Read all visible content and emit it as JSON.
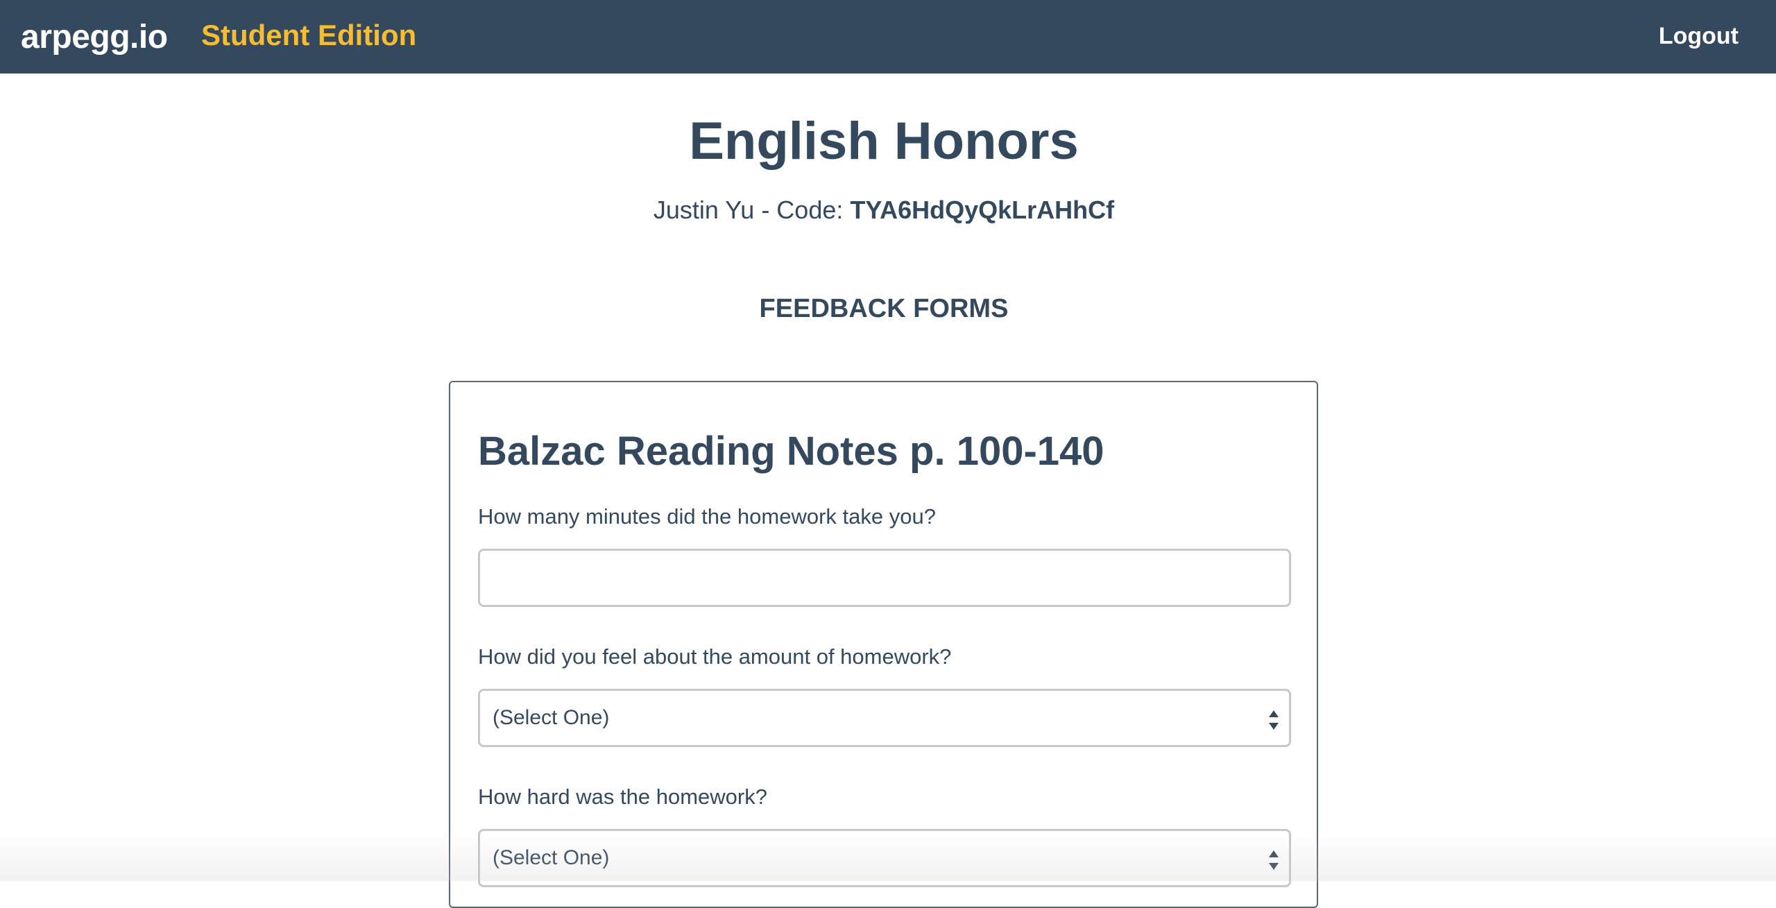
{
  "navbar": {
    "brand": "arpegg.io",
    "edition": "Student Edition",
    "logout_label": "Logout"
  },
  "course": {
    "title": "English Honors",
    "student_prefix": "Justin Yu - Code: ",
    "code": "TYA6HdQyQkLrAHhCf"
  },
  "section": {
    "heading": "FEEDBACK FORMS"
  },
  "form": {
    "title": "Balzac Reading Notes p. 100-140",
    "questions": [
      {
        "label": "How many minutes did the homework take you?",
        "type": "text",
        "value": ""
      },
      {
        "label": "How did you feel about the amount of homework?",
        "type": "select",
        "selected": "(Select One)"
      },
      {
        "label": "How hard was the homework?",
        "type": "select",
        "selected": "(Select One)"
      }
    ]
  },
  "colors": {
    "navbar_bg": "#34495e",
    "accent": "#f6bd30",
    "text": "#34495e"
  }
}
